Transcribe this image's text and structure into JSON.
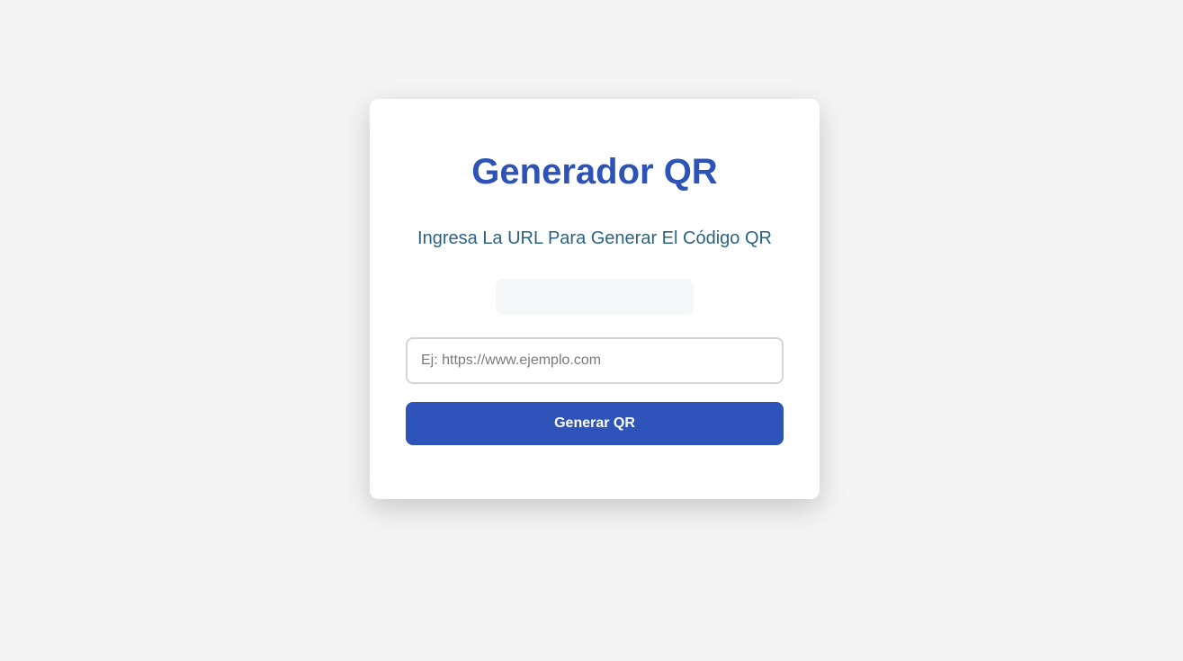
{
  "card": {
    "title": "Generador QR",
    "subtitle": "Ingresa La URL Para Generar El Código QR",
    "url_input": {
      "value": "",
      "placeholder": "Ej: https://www.ejemplo.com"
    },
    "generate_button_label": "Generar QR"
  },
  "colors": {
    "background": "#f4f4f4",
    "card": "#ffffff",
    "title": "#2d53b6",
    "subtitle": "#2b6384",
    "button": "#2e53b9"
  }
}
